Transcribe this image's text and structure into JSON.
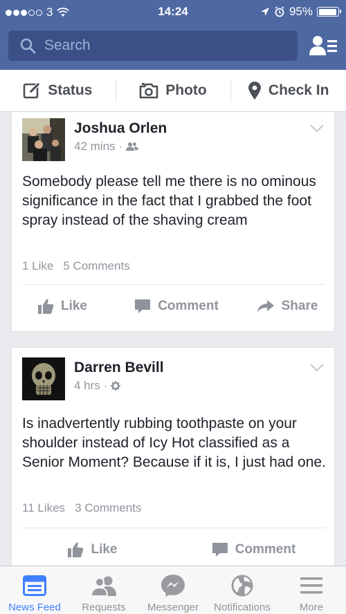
{
  "status_bar": {
    "carrier": "3",
    "time": "14:24",
    "battery_percent": "95%",
    "battery_level": 0.95
  },
  "header": {
    "search_placeholder": "Search",
    "icons": [
      "search-icon",
      "friends-list-icon"
    ]
  },
  "composer": {
    "status_label": "Status",
    "photo_label": "Photo",
    "checkin_label": "Check In"
  },
  "posts": [
    {
      "author": "Joshua Orlen",
      "time": "42 mins",
      "privacy_icon": "friends-icon",
      "text": "Somebody please tell me there is no ominous significance in the fact that I grabbed the foot spray instead of the shaving cream",
      "likes": "1 Like",
      "comments": "5 Comments",
      "actions": {
        "like": "Like",
        "comment": "Comment",
        "share": "Share"
      }
    },
    {
      "author": "Darren Bevill",
      "time": "4 hrs",
      "privacy_icon": "gear-icon",
      "text": "Is inadvertently rubbing toothpaste on your shoulder instead of Icy Hot classified as a Senior Moment? Because if it is, I just had one.",
      "likes": "11 Likes",
      "comments": "3 Comments",
      "actions": {
        "like": "Like",
        "comment": "Comment"
      }
    }
  ],
  "tabbar": {
    "items": [
      {
        "label": "News Feed",
        "icon": "news-feed-icon",
        "active": true
      },
      {
        "label": "Requests",
        "icon": "requests-icon",
        "active": false
      },
      {
        "label": "Messenger",
        "icon": "messenger-icon",
        "active": false
      },
      {
        "label": "Notifications",
        "icon": "globe-icon",
        "active": false
      },
      {
        "label": "More",
        "icon": "menu-icon",
        "active": false
      }
    ]
  },
  "colors": {
    "brand": "#4e69a2",
    "active_tab": "#4080ff",
    "muted_text": "#90949c"
  }
}
